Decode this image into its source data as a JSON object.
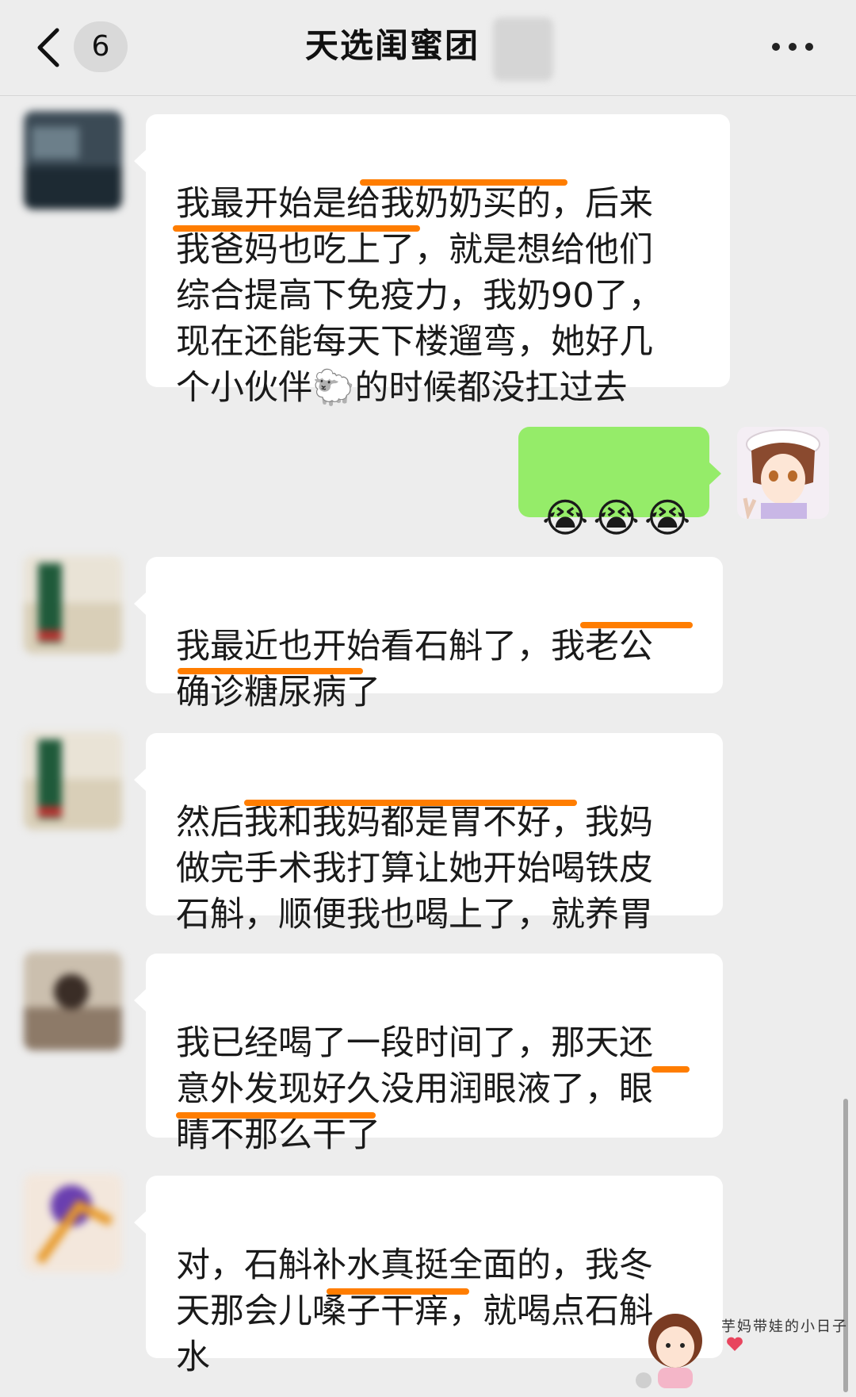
{
  "header": {
    "back_icon": "chevron-left-icon",
    "unread_count": "6",
    "title": "天选闺蜜团",
    "more_icon": "ellipsis-icon"
  },
  "messages": [
    {
      "side": "left",
      "text": "我最开始是给我奶奶买的，后来\n我爸妈也吃上了，就是想给他们\n综合提高下免疫力，我奶90了，\n现在还能每天下楼遛弯，她好几\n个小伙伴🐑的时候都没扛过去"
    },
    {
      "side": "right",
      "text": "😭😭😭"
    },
    {
      "side": "left",
      "text": "我最近也开始看石斛了，我老公\n确诊糖尿病了"
    },
    {
      "side": "left",
      "text": "然后我和我妈都是胃不好，我妈\n做完手术我打算让她开始喝铁皮\n石斛，顺便我也喝上了，就养胃"
    },
    {
      "side": "left",
      "text": "我已经喝了一段时间了，那天还\n意外发现好久没用润眼液了，眼\n睛不那么干了"
    },
    {
      "side": "left",
      "text": "对，石斛补水真挺全面的，我冬\n天那会儿嗓子干痒，就喝点石斛\n水"
    }
  ],
  "watermark": {
    "text": "芋妈带娃的小日子"
  },
  "colors": {
    "highlight": "#ff7d00",
    "self_bubble": "#95ec69",
    "background": "#ededed"
  }
}
